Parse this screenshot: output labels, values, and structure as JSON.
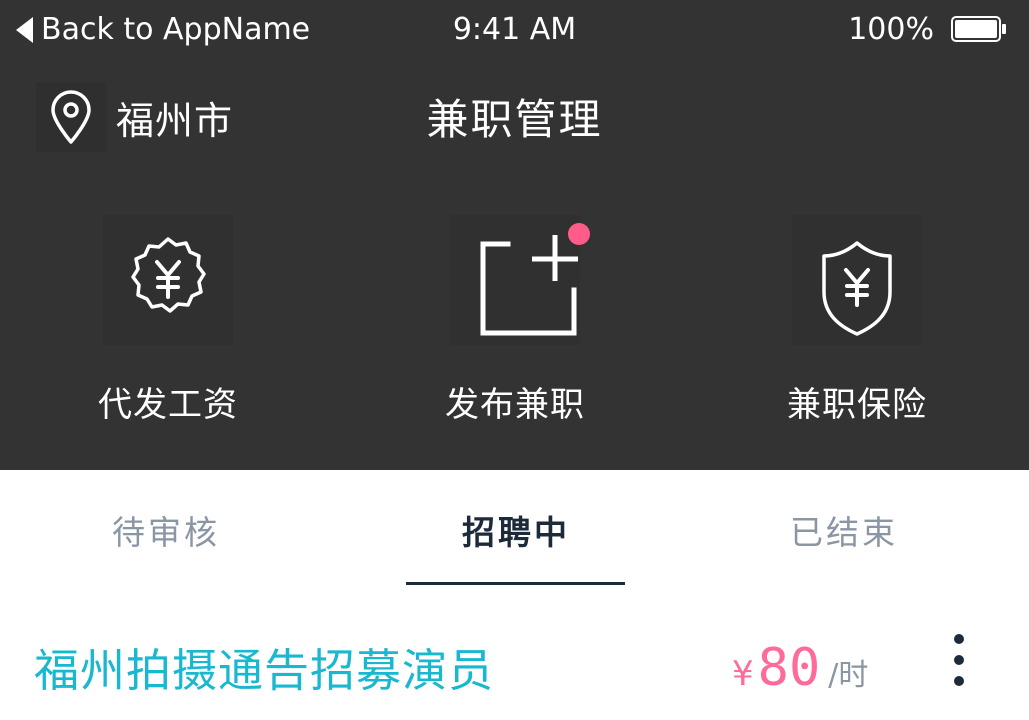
{
  "status_bar": {
    "back_label": "Back to AppName",
    "time": "9:41 AM",
    "battery": "100%"
  },
  "header": {
    "location": "福州市",
    "title": "兼职管理"
  },
  "actions": [
    {
      "label": "代发工资",
      "icon": "yen-badge-icon"
    },
    {
      "label": "发布兼职",
      "icon": "add-post-icon",
      "has_notification": true
    },
    {
      "label": "兼职保险",
      "icon": "yen-shield-icon"
    }
  ],
  "tabs": [
    {
      "label": "待审核",
      "active": false
    },
    {
      "label": "招聘中",
      "active": true
    },
    {
      "label": "已结束",
      "active": false
    }
  ],
  "jobs": [
    {
      "title": "福州拍摄通告招募演员",
      "currency": "¥",
      "price": "80",
      "unit": "/时"
    }
  ],
  "colors": {
    "header_bg": "#333333",
    "accent": "#19b7d0",
    "price": "#ff6b99",
    "badge": "#ff5c8a",
    "tab_active": "#1c2a3a",
    "tab_inactive": "#8a96a3"
  }
}
